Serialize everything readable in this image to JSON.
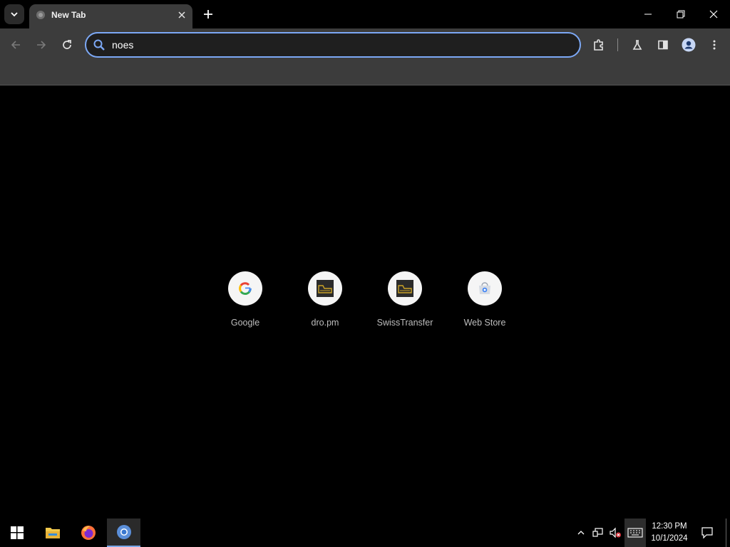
{
  "browser": {
    "tab": {
      "title": "New Tab"
    },
    "omnibox": {
      "value": "noes"
    }
  },
  "new_tab_page": {
    "shortcuts": [
      {
        "label": "Google",
        "icon": "google-g-icon"
      },
      {
        "label": "dro.pm",
        "icon": "dro-pm-site-icon"
      },
      {
        "label": "SwissTransfer",
        "icon": "swisstransfer-site-icon"
      },
      {
        "label": "Web Store",
        "icon": "chrome-web-store-icon"
      }
    ]
  },
  "taskbar": {
    "apps": [
      "windows-start-icon",
      "file-explorer-icon",
      "firefox-icon",
      "chrome-icon"
    ],
    "clock": {
      "time": "12:30 PM",
      "date": "10/1/2024"
    }
  },
  "colors": {
    "accent": "#7ca8f5",
    "toolbar": "#3c3c3c",
    "page_background": "#000000"
  }
}
